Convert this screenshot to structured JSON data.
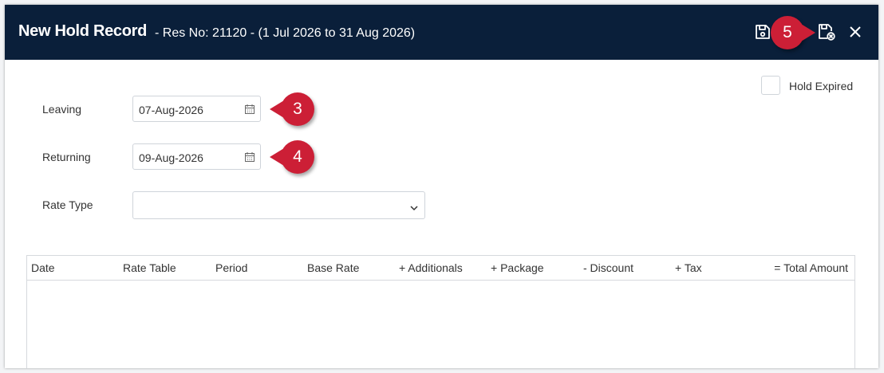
{
  "header": {
    "title": "New Hold Record",
    "subtitle": "- Res No: 21120 - (1 Jul 2026 to 31 Aug 2026)"
  },
  "callouts": [
    "3",
    "4",
    "5"
  ],
  "form": {
    "leaving_label": "Leaving",
    "leaving_value": "07-Aug-2026",
    "returning_label": "Returning",
    "returning_value": "09-Aug-2026",
    "rate_type_label": "Rate Type",
    "rate_type_value": "",
    "hold_expired_label": "Hold Expired",
    "hold_expired_checked": false
  },
  "table": {
    "columns": [
      "Date",
      "Rate Table",
      "Period",
      "Base Rate",
      "+ Additionals",
      "+ Package",
      "- Discount",
      "+ Tax",
      "= Total Amount"
    ],
    "rows": []
  },
  "icons": {
    "save": "save-icon",
    "save_close": "save-close-icon",
    "close": "close-icon",
    "calendar": "calendar-icon",
    "dropdown": "chevron-down-icon"
  },
  "colors": {
    "header_bg": "#0a1f3a",
    "callout": "#cc1f36"
  }
}
